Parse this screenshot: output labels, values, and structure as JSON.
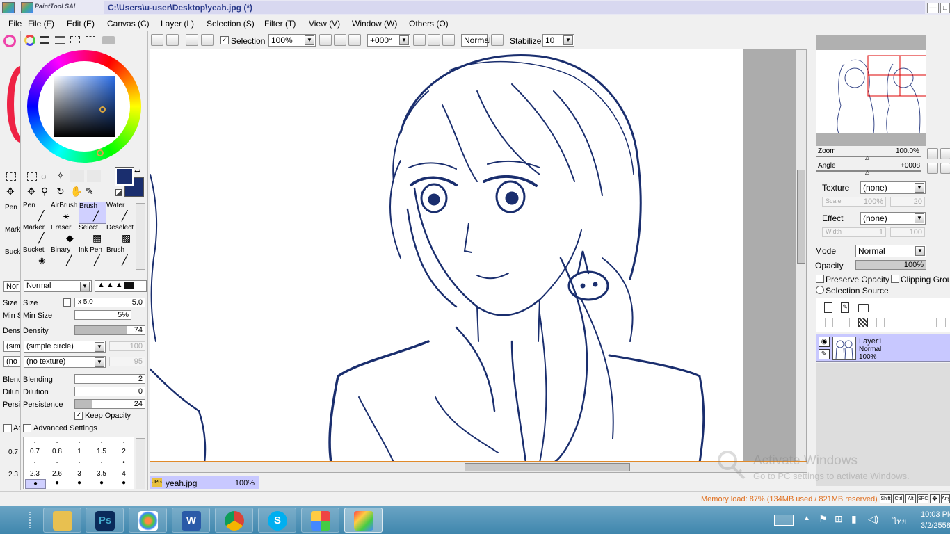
{
  "window": {
    "title": "C:\\Users\\u-user\\Desktop\\yeah.jpg (*)",
    "app_logo_text": "PaintTool SAI"
  },
  "menu": [
    "File (F)",
    "Edit (E)",
    "Canvas (C)",
    "Layer (L)",
    "Selection (S)",
    "Filter (T)",
    "View (V)",
    "Window (W)",
    "Others (O)"
  ],
  "back_menu_file": "File",
  "toolbar": {
    "selection_label": "Selection",
    "zoom": "100%",
    "rotation": "+000°",
    "blend_mode": "Normal",
    "stabilizer_label": "Stabilizer",
    "stabilizer_value": "10"
  },
  "tools": {
    "rows": [
      [
        "Pen",
        "AirBrush",
        "Brush",
        "Water"
      ],
      [
        "Marker",
        "Eraser",
        "Select",
        "Deselect"
      ],
      [
        "Bucket",
        "Binary",
        "Ink Pen",
        "Brush"
      ]
    ],
    "selected": "Brush",
    "back_rows": [
      "Pen",
      "Mark",
      "Buck"
    ],
    "blend_mode": "Normal",
    "back_blend": "Nor"
  },
  "brush": {
    "size_label": "Size",
    "size_mult": "x 5.0",
    "size_value": "5.0",
    "min_size_label": "Min Size",
    "min_size_value": "5%",
    "density_label": "Density",
    "density_value": "74",
    "density_fill": 0.74,
    "shape": "(simple circle)",
    "shape_value": "100",
    "texture": "(no texture)",
    "texture_value": "95",
    "blending_label": "Blending",
    "blending_value": "2",
    "dilution_label": "Dilution",
    "dilution_value": "0",
    "persistence_label": "Persistence",
    "persistence_value": "24",
    "persistence_fill": 0.24,
    "keep_opacity_label": "Keep Opacity",
    "advanced_label": "Advanced Settings",
    "back_labels": [
      "Size",
      "Min S",
      "Dens",
      "(sim",
      "(no",
      "Blend",
      "Diluti",
      "Persi"
    ],
    "back_adv": "Ad",
    "size_row1": [
      "0.7",
      "0.8",
      "1",
      "1.5",
      "2"
    ],
    "size_row2": [
      "2.3",
      "2.6",
      "3",
      "3.5",
      "4"
    ],
    "back_size_row1": "0.7",
    "back_size_row2": "2.3"
  },
  "colors": {
    "primary": "#1a2e6e",
    "secondary": "#1a2e6e",
    "accent_frame": "#e08a2a"
  },
  "document_tab": {
    "name": "yeah.jpg",
    "zoom": "100%"
  },
  "navigator": {
    "zoom_label": "Zoom",
    "zoom_value": "100.0%",
    "angle_label": "Angle",
    "angle_value": "+0008"
  },
  "layer_props": {
    "texture_label": "Texture",
    "texture_value": "(none)",
    "scale_label": "Scale",
    "scale_value": "100%",
    "scale_extra": "20",
    "effect_label": "Effect",
    "effect_value": "(none)",
    "width_label": "Width",
    "width_value": "1",
    "width_extra": "100",
    "mode_label": "Mode",
    "mode_value": "Normal",
    "opacity_label": "Opacity",
    "opacity_value": "100%",
    "preserve_opacity": "Preserve Opacity",
    "clipping_group": "Clipping Group",
    "selection_source": "Selection Source"
  },
  "layers": [
    {
      "name": "Layer1",
      "mode": "Normal",
      "opacity": "100%"
    }
  ],
  "status": {
    "memory": "Memory load: 87% (134MB used / 821MB reserved)",
    "keys": [
      "Shift",
      "Ctrl",
      "Alt",
      "SPC",
      "Any"
    ]
  },
  "watermark": {
    "line1": "Activate Windows",
    "line2": "Go to PC settings to activate Windows."
  },
  "taskbar": {
    "apps": [
      "file-explorer",
      "photoshop",
      "paint",
      "word",
      "chrome",
      "skype",
      "games",
      "painttool-sai"
    ],
    "photoshop_label": "Ps",
    "word_label": "W",
    "skype_label": "S",
    "lang": "ไทย",
    "time": "10:03 PM",
    "date": "3/2/2558"
  }
}
